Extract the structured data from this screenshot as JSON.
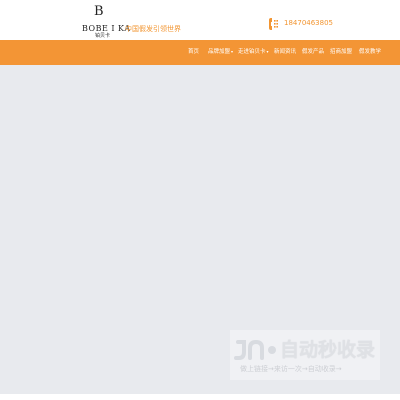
{
  "brand": {
    "monogram": "B",
    "name_en": "BOBE I KA",
    "name_cn": "铂贝卡",
    "slogan": "中国假发引领世界"
  },
  "contact": {
    "phone": "18470463805",
    "icon": "phone-icon"
  },
  "nav": {
    "items": [
      {
        "label": "首页",
        "has_dropdown": false
      },
      {
        "label": "品牌加盟",
        "has_dropdown": true
      },
      {
        "label": "走进铂贝卡",
        "has_dropdown": true
      },
      {
        "label": "新闻资讯",
        "has_dropdown": false
      },
      {
        "label": "假发产品",
        "has_dropdown": false
      },
      {
        "label": "招商加盟",
        "has_dropdown": false
      },
      {
        "label": "假发教学",
        "has_dropdown": false
      }
    ],
    "caret": "▾"
  },
  "watermark": {
    "title": "自动秒收录",
    "subtitle": "做上链接→来访一次→自动收录→"
  },
  "colors": {
    "accent": "#f39535",
    "slogan": "#f29531",
    "main_bg": "#e8eaee"
  }
}
